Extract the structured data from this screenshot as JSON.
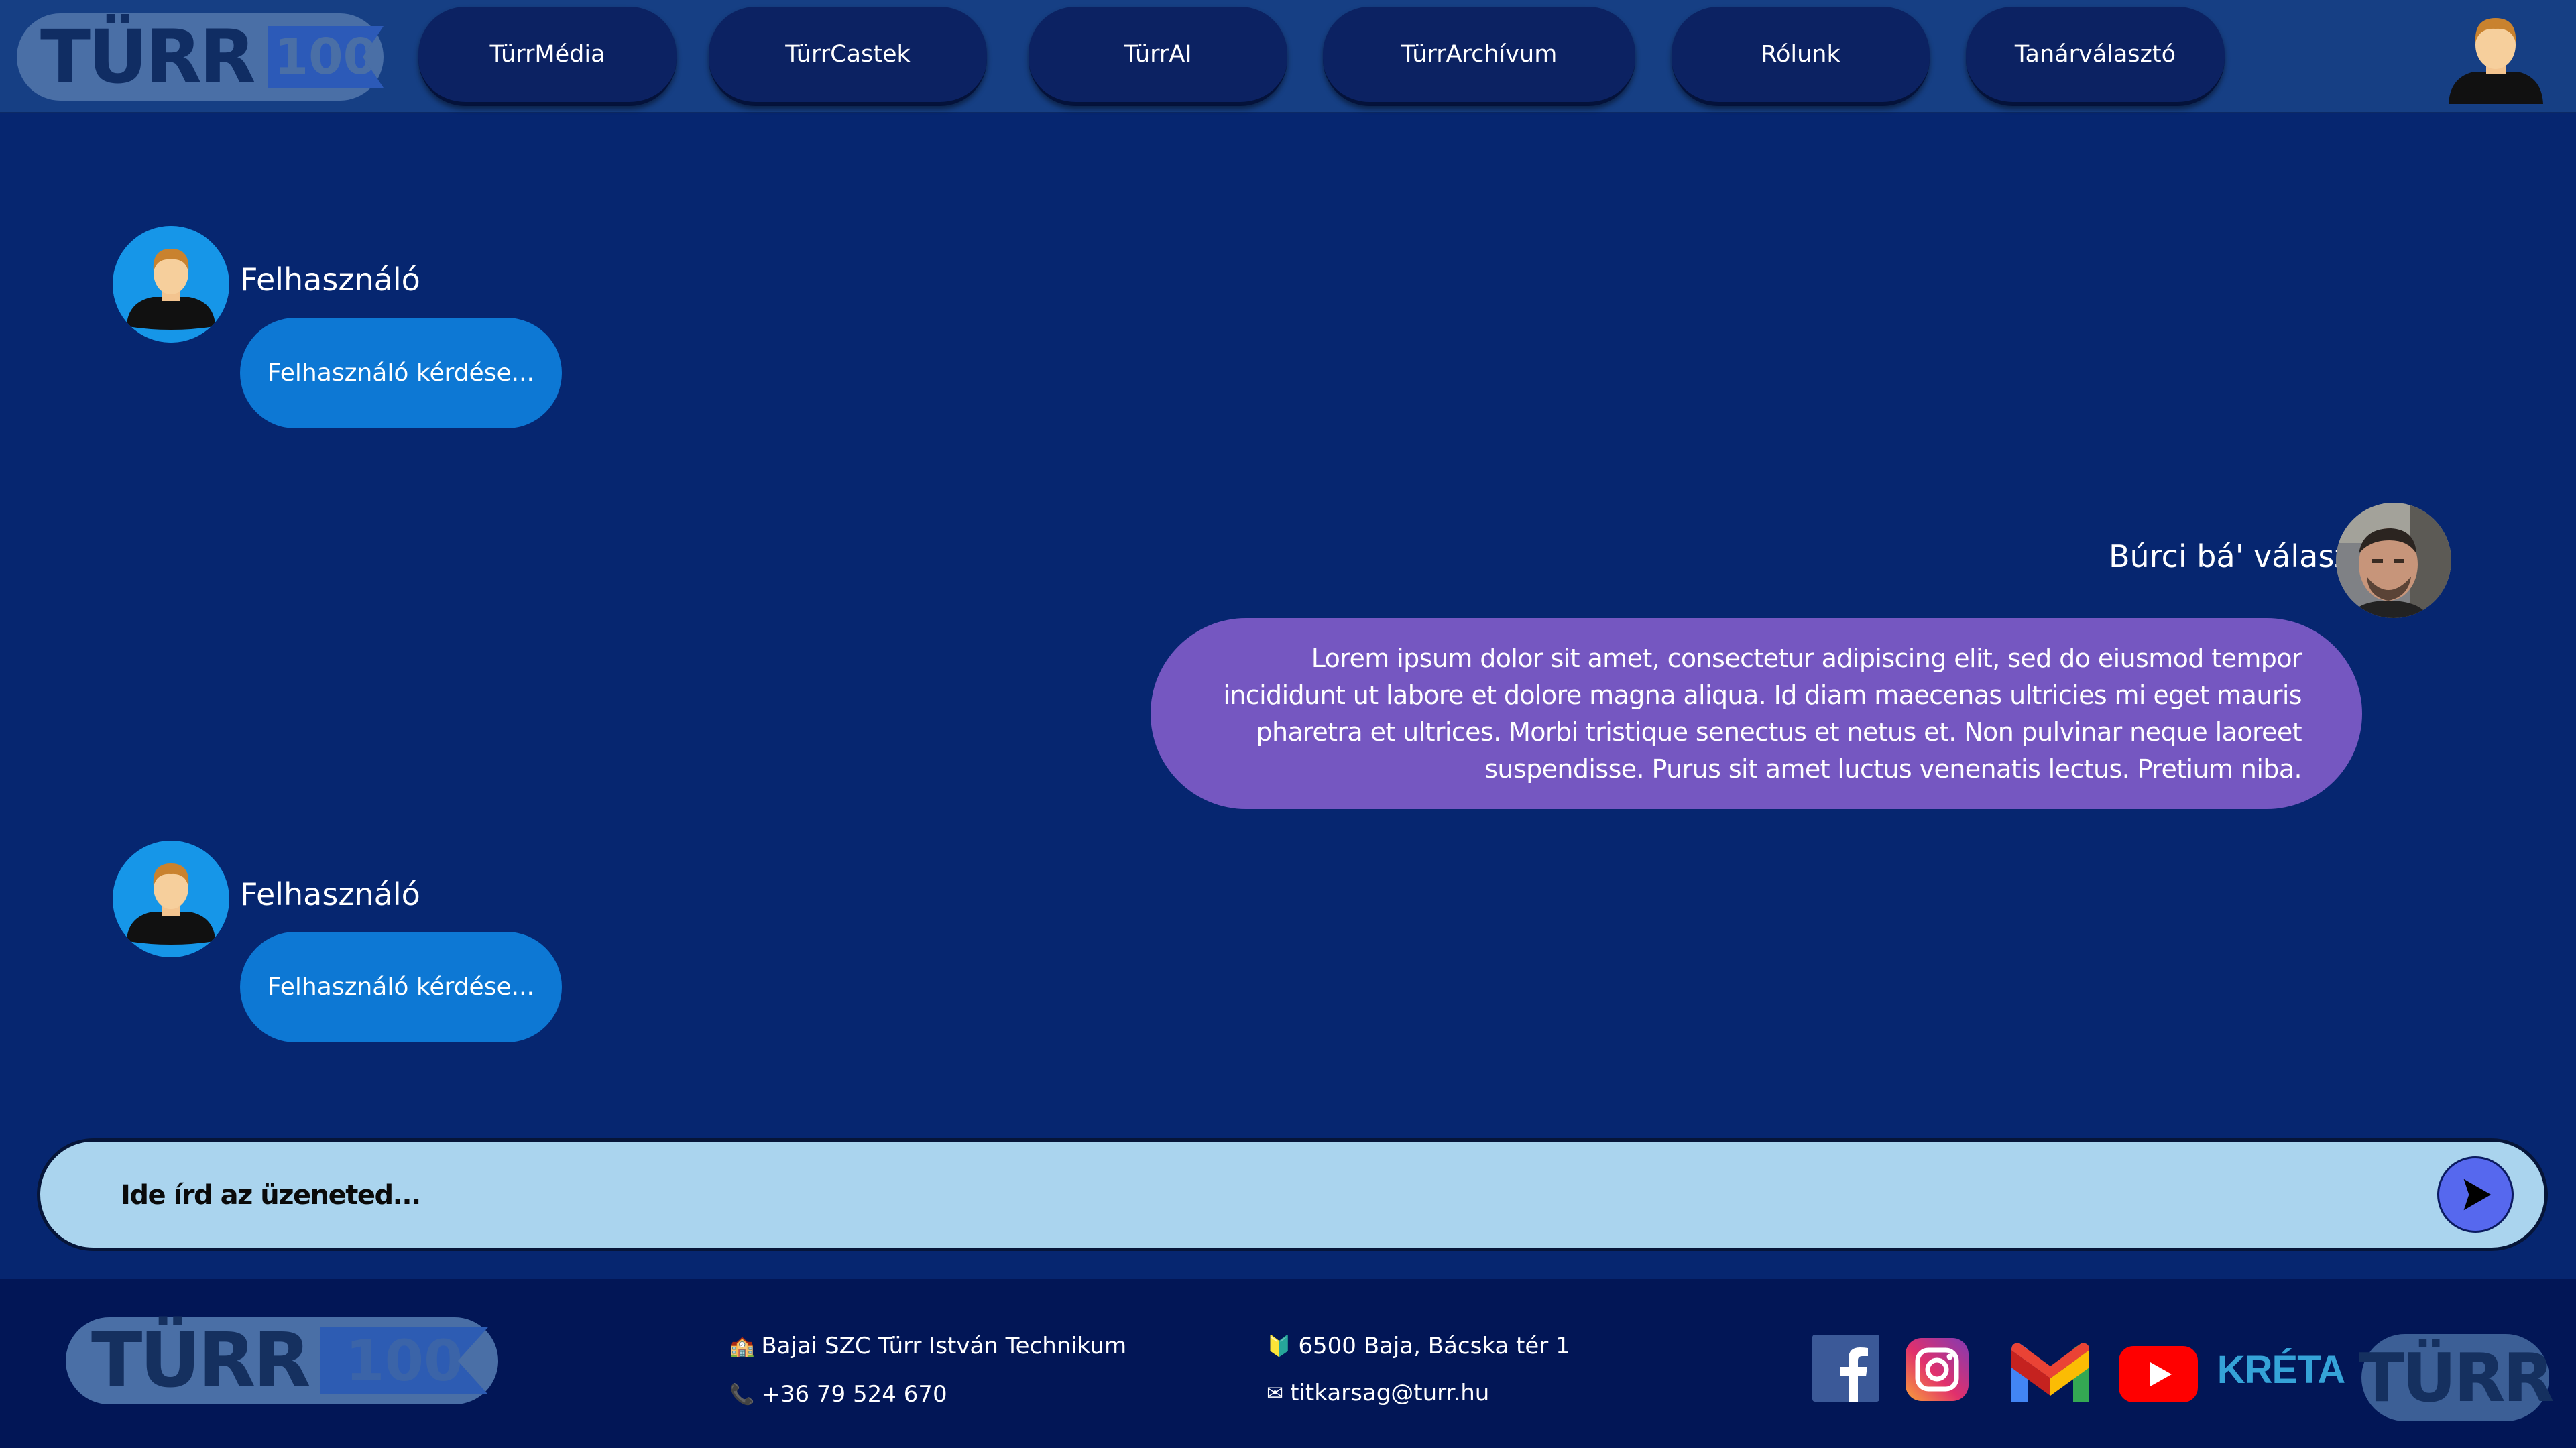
{
  "header": {
    "logo_text": "TÜRR",
    "logo_badge": "100",
    "nav": [
      {
        "label": "TürrMédia"
      },
      {
        "label": "TürrCastek"
      },
      {
        "label": "TürrAI"
      },
      {
        "label": "TürrArchívum"
      },
      {
        "label": "Rólunk"
      },
      {
        "label": "Tanárválasztó"
      }
    ],
    "profile_icon": "user-avatar-icon"
  },
  "chat": {
    "messages": [
      {
        "sender": "Felhasználó",
        "text": "Felhasználó kérdése..."
      },
      {
        "sender": "Búrci bá' válasz",
        "text": "Lorem ipsum dolor sit amet, consectetur adipiscing elit, sed do eiusmod tempor incididunt ut labore et dolore magna aliqua. Id diam maecenas ultricies mi eget mauris pharetra et ultrices. Morbi tristique senectus et netus et. Non pulvinar neque laoreet suspendisse. Purus sit amet luctus venenatis lectus. Pretium niba."
      },
      {
        "sender": "Felhasználó",
        "text": "Felhasználó kérdése..."
      }
    ]
  },
  "input": {
    "placeholder": "Ide írd az üzeneted...",
    "send_icon": "send-arrow-icon"
  },
  "footer": {
    "logo_text": "TÜRR",
    "logo_badge": "100",
    "school": "Bajai SZC Türr István Technikum",
    "phone": "+36 79 524 670",
    "address": "6500 Baja, Bácska tér 1",
    "email": "titkarsag@turr.hu",
    "social": [
      "facebook-icon",
      "instagram-icon",
      "gmail-icon",
      "youtube-icon",
      "kreta-icon"
    ],
    "kreta_label": "KRÉTA",
    "small_logo_text": "TÜRR"
  },
  "colors": {
    "background": "#062670",
    "header": "#163f84",
    "footer": "#021656",
    "nav_button": "#0c2262",
    "user_bubble": "#0d78d4",
    "bot_bubble": "#7557c1",
    "input_bar": "#aad4ee",
    "send_button": "#5668ee"
  }
}
